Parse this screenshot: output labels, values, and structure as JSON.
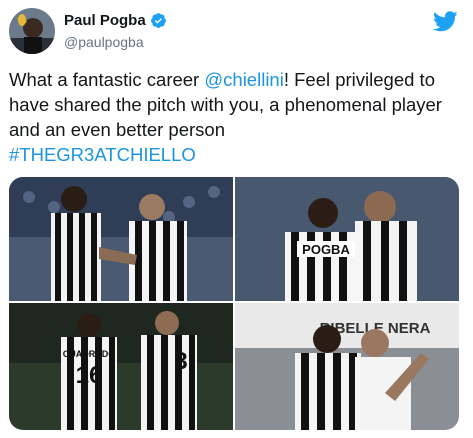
{
  "author": {
    "display_name": "Paul Pogba",
    "handle": "@paulpogba",
    "verified": true,
    "avatar_icon": "avatar-photo"
  },
  "tweet": {
    "text_before": "What a fantastic career ",
    "mention": "@chiellini",
    "text_after": "! Feel privileged to have shared the pitch with you, a phenomenal player and an even better person",
    "hashtag": "#THEGR3ATCHIELLO"
  },
  "media": {
    "photos": [
      {
        "icon": "photo-players-stadium"
      },
      {
        "icon": "photo-players-embrace",
        "shirt_text": "POGBA"
      },
      {
        "icon": "photo-players-walking",
        "shirt_text_1": "CUADRADO",
        "shirt_num_1": "16",
        "shirt_num_2": "3"
      },
      {
        "icon": "photo-players-celebrate",
        "banner_text": "RIBELLE NERA"
      }
    ]
  },
  "colors": {
    "link": "#1b95e0",
    "twitter_blue": "#1da1f2",
    "text": "#14171a",
    "secondary_text": "#657786"
  }
}
